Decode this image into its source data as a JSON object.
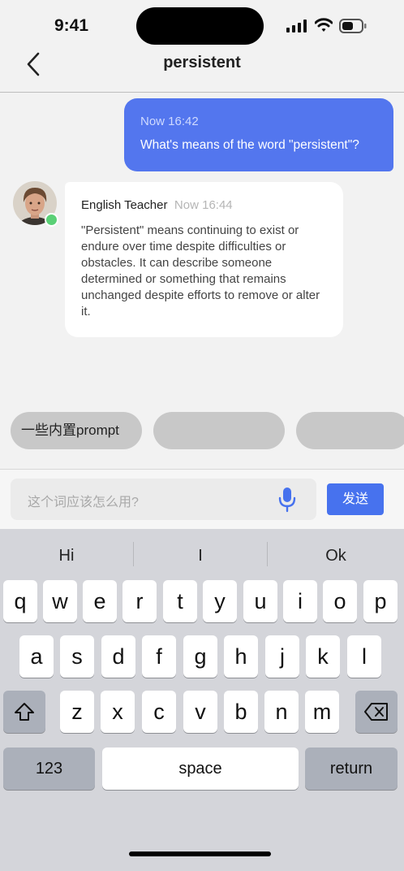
{
  "status": {
    "time": "9:41"
  },
  "nav": {
    "title": "persistent",
    "back_icon": "chevron-left-icon"
  },
  "chat": {
    "user_message": {
      "time": "Now 16:42",
      "text": "What's means of the word \"persistent\"?"
    },
    "bot_message": {
      "sender": "English Teacher",
      "time": "Now 16:44",
      "text": "\"Persistent\" means continuing to exist or endure over time despite difficulties or obstacles. It can describe someone determined or something that remains unchanged despite efforts to remove or alter it."
    }
  },
  "prompts": {
    "chip1": "一些内置prompt",
    "chip2": "",
    "chip3": ""
  },
  "composer": {
    "placeholder": "这个词应该怎么用?",
    "send_label": "发送"
  },
  "keyboard": {
    "suggestions": [
      "Hi",
      "I",
      "Ok"
    ],
    "row1": [
      "q",
      "w",
      "e",
      "r",
      "t",
      "y",
      "u",
      "i",
      "o",
      "p"
    ],
    "row2": [
      "a",
      "s",
      "d",
      "f",
      "g",
      "h",
      "j",
      "k",
      "l"
    ],
    "row3": [
      "z",
      "x",
      "c",
      "v",
      "b",
      "n",
      "m"
    ],
    "numbers_label": "123",
    "space_label": "space",
    "return_label": "return"
  },
  "colors": {
    "accent": "#4772ee",
    "user_bubble": "#5376ee",
    "online": "#5ad076"
  }
}
